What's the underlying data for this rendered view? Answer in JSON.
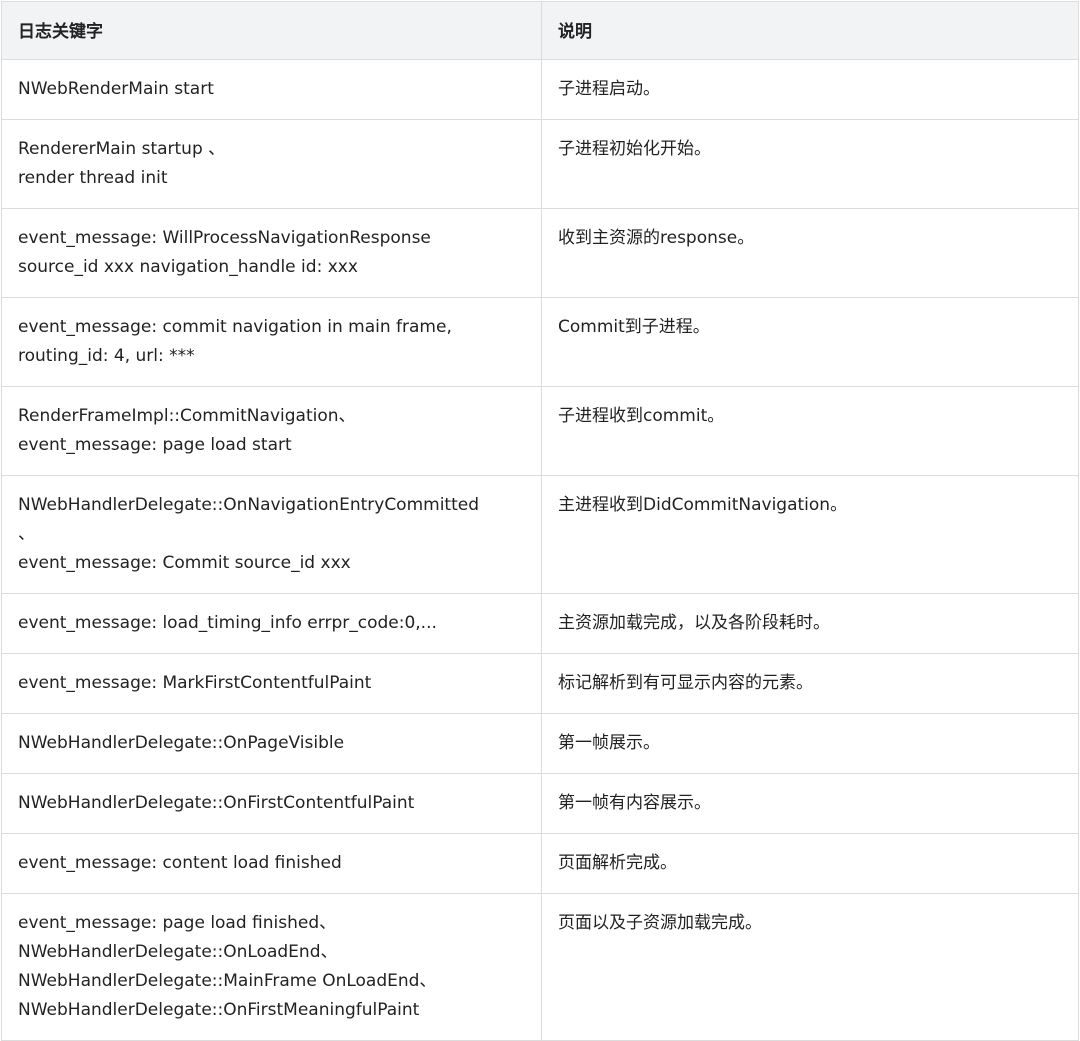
{
  "table": {
    "headers": [
      "日志关键字",
      "说明"
    ],
    "rows": [
      {
        "keyword": [
          "NWebRenderMain start"
        ],
        "description": "子进程启动。"
      },
      {
        "keyword": [
          "RendererMain startup 、",
          "render thread init"
        ],
        "description": "子进程初始化开始。"
      },
      {
        "keyword": [
          "event_message: WillProcessNavigationResponse",
          "source_id xxx navigation_handle id: xxx"
        ],
        "description": "收到主资源的response。"
      },
      {
        "keyword": [
          "event_message: commit navigation in main frame,",
          "routing_id: 4, url: ***"
        ],
        "description": "Commit到子进程。"
      },
      {
        "keyword": [
          "RenderFrameImpl::CommitNavigation、",
          "event_message: page load start"
        ],
        "description": "子进程收到commit。"
      },
      {
        "keyword": [
          "NWebHandlerDelegate::OnNavigationEntryCommitted",
          "、",
          "event_message: Commit source_id xxx"
        ],
        "description": "主进程收到DidCommitNavigation。"
      },
      {
        "keyword": [
          "event_message: load_timing_info errpr_code:0,..."
        ],
        "description": "主资源加载完成，以及各阶段耗时。"
      },
      {
        "keyword": [
          "event_message: MarkFirstContentfulPaint"
        ],
        "description": "标记解析到有可显示内容的元素。"
      },
      {
        "keyword": [
          "NWebHandlerDelegate::OnPageVisible"
        ],
        "description": "第一帧展示。"
      },
      {
        "keyword": [
          "NWebHandlerDelegate::OnFirstContentfulPaint"
        ],
        "description": "第一帧有内容展示。"
      },
      {
        "keyword": [
          "event_message: content load finished"
        ],
        "description": "页面解析完成。"
      },
      {
        "keyword": [
          "event_message: page load finished、",
          "NWebHandlerDelegate::OnLoadEnd、",
          "NWebHandlerDelegate::MainFrame OnLoadEnd、",
          "NWebHandlerDelegate::OnFirstMeaningfulPaint"
        ],
        "description": "页面以及子资源加载完成。"
      }
    ]
  }
}
